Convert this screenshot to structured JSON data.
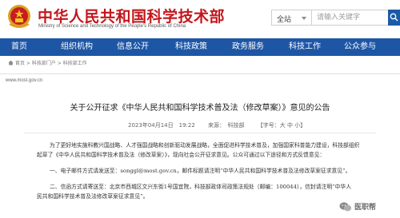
{
  "header": {
    "title": "中华人民共和国科学技术部",
    "subtitle": "Ministry of Science and Technology of the People's Republic of China",
    "search_scope": "全站",
    "search_placeholder": "请输入关键字",
    "emblem_icon": "national-emblem-icon"
  },
  "nav": {
    "items": [
      {
        "label": "首页"
      },
      {
        "label": "组织机构"
      },
      {
        "label": "信息公开"
      },
      {
        "label": "科技政策"
      },
      {
        "label": "政务服务"
      },
      {
        "label": "科技工作"
      },
      {
        "label": "公众参与"
      }
    ],
    "color": "#1e56a6"
  },
  "breadcrumb": "首页 > 科技部门户 > 科技部工作",
  "url": "www.most.gov.cn",
  "article": {
    "title": "关于公开征求《中华人民共和国科学技术普及法（修改草案）》意见的公告",
    "date": "2023年04月14日　19:22",
    "source": "来源：　科技部",
    "font_size": "【字号：大 中 小】",
    "p1_line1": "为了更好地实施科教兴国战略、人才强国战略和创新驱动发展战略，全面促进科学技术普及，加强国家科普能力建设，科技部组织",
    "p1_line2": "起草了《中华人民共和国科学技术普及法（修改草案）》，现向社会公开征求意见。公众可通过以下途径和方式反馈意见：",
    "p2": "一、电子邮件方式请发送至：songgl@most.gov.cn，邮件标题请注明“中华人民共和国科学技术普及法修改草案征求意见”。",
    "p3_line1": "二、信函方式请寄送至：北京市西城区文兴东街1号国宜院，科技部政体司政策法规处（邮编：100044），信封请注明“中华人",
    "p3_line2": "民共和国科学技术普及法修改草案征求意见”。"
  },
  "watermark": {
    "text": "医职帮",
    "icon": "wechat-icon"
  },
  "colors": {
    "brand_red": "#c4161c",
    "nav_blue": "#1e56a6"
  }
}
